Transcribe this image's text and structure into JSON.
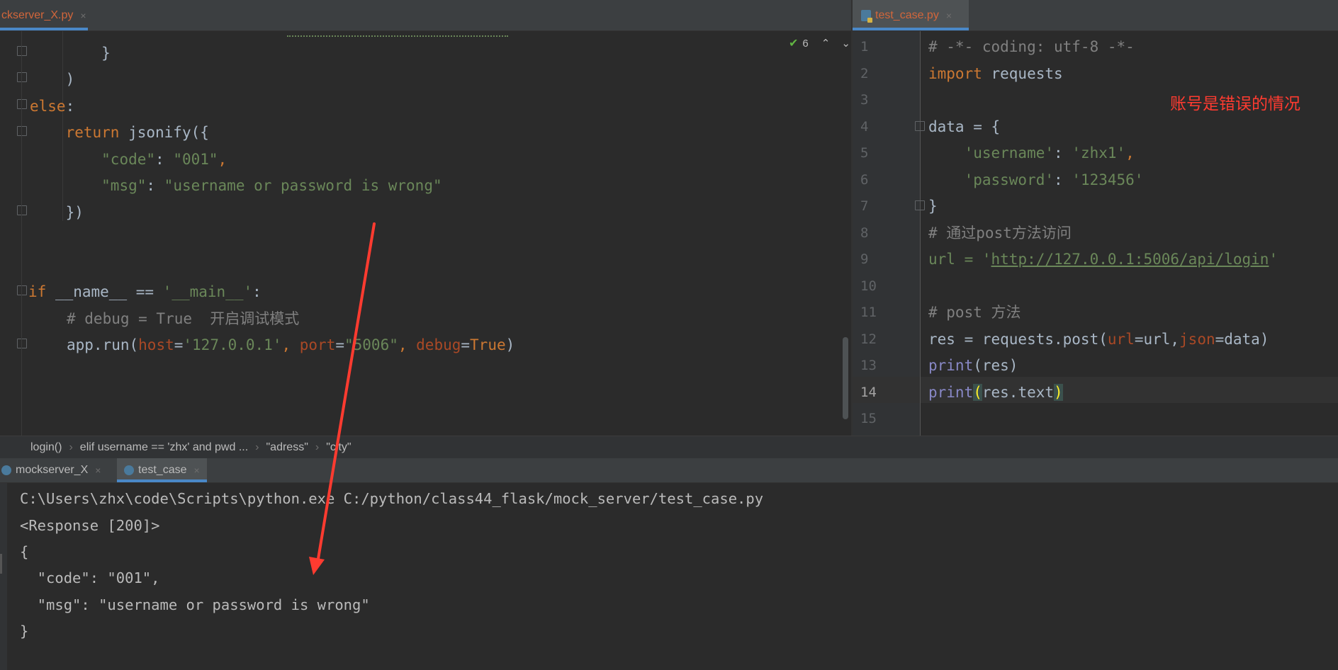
{
  "left_tab": {
    "label": "ckserver_X.py",
    "close": "×"
  },
  "right_tab": {
    "label": "test_case.py",
    "close": "×"
  },
  "inspection": {
    "count": "6"
  },
  "left_code": [
    {
      "indent": "            ",
      "text": "}",
      "cls": ""
    },
    {
      "indent": "        ",
      "text": ")",
      "cls": ""
    },
    {
      "indent": "    ",
      "text": "else:",
      "cls": "kw"
    }
  ],
  "left_lines": {
    "l1": "}",
    "l2": ")",
    "else_kw": "else",
    "else_colon": ":",
    "return_kw": "return",
    "jsonify": " jsonify({",
    "code_key": "\"code\"",
    "code_sep": ": ",
    "code_val": "\"001\"",
    "code_comma": ",",
    "msg_key": "\"msg\"",
    "msg_sep": ": ",
    "msg_val": "\"username or password is wrong\"",
    "close_brace": "})",
    "if_kw": "if",
    "name_var": " __name__",
    "eq": " == ",
    "main_str": "'__main__'",
    "colon": ":",
    "debug_comment": "# debug = True  开启调试模式",
    "run_prefix": "app.run(",
    "host_kw": "host",
    "host_val": "'127.0.0.1'",
    "comma1": ", ",
    "port_kw": "port",
    "port_val": "\"5006\"",
    "comma2": ", ",
    "debug_kw": "debug",
    "true_val": "True",
    "run_suffix": ")",
    "equals": "="
  },
  "right_line_numbers": [
    "1",
    "2",
    "3",
    "4",
    "5",
    "6",
    "7",
    "8",
    "9",
    "10",
    "11",
    "12",
    "13",
    "14",
    "15"
  ],
  "right_code": {
    "c1": "# -*- coding: utf-8 -*-",
    "import_kw": "import",
    "import_mod": " requests",
    "data_open": "data = {",
    "user_key": "'username'",
    "user_sep": ": ",
    "user_val": "'zhx1'",
    "user_comma": ",",
    "pwd_key": "'password'",
    "pwd_sep": ": ",
    "pwd_val": "'123456'",
    "data_close": "}",
    "c8": "# 通过post方法访问",
    "url_prefix": "url = '",
    "url_link": "http://127.0.0.1:5006/api/login",
    "url_suffix": "'",
    "c11": "# post 方法",
    "res_prefix": "res = requests.post(",
    "url_kw": "url",
    "res_mid1": "=url,",
    "json_kw": "json",
    "res_mid2": "=data)",
    "print1": "print",
    "print1_arg": "(res)",
    "print2": "print",
    "print2_open": "(",
    "print2_arg": "res.text",
    "print2_close": ")"
  },
  "annotation": {
    "text": "账号是错误的情况",
    "color": "#ff3b30"
  },
  "breadcrumb": [
    "login()",
    "elif username == 'zhx' and pwd ...",
    "\"adress\"",
    "\"city\""
  ],
  "run_tabs": [
    {
      "label": "mockserver_X",
      "close": "×"
    },
    {
      "label": "test_case",
      "close": "×"
    }
  ],
  "console": [
    "C:\\Users\\zhx\\code\\Scripts\\python.exe C:/python/class44_flask/mock_server/test_case.py",
    "<Response [200]>",
    "{",
    "  \"code\": \"001\",",
    "  \"msg\": \"username or password is wrong\"",
    "}"
  ],
  "colors": {
    "keyword": "#cc7832",
    "string": "#6a8759",
    "comment": "#808080",
    "param": "#aa4926",
    "arrow": "#ff3b30"
  }
}
